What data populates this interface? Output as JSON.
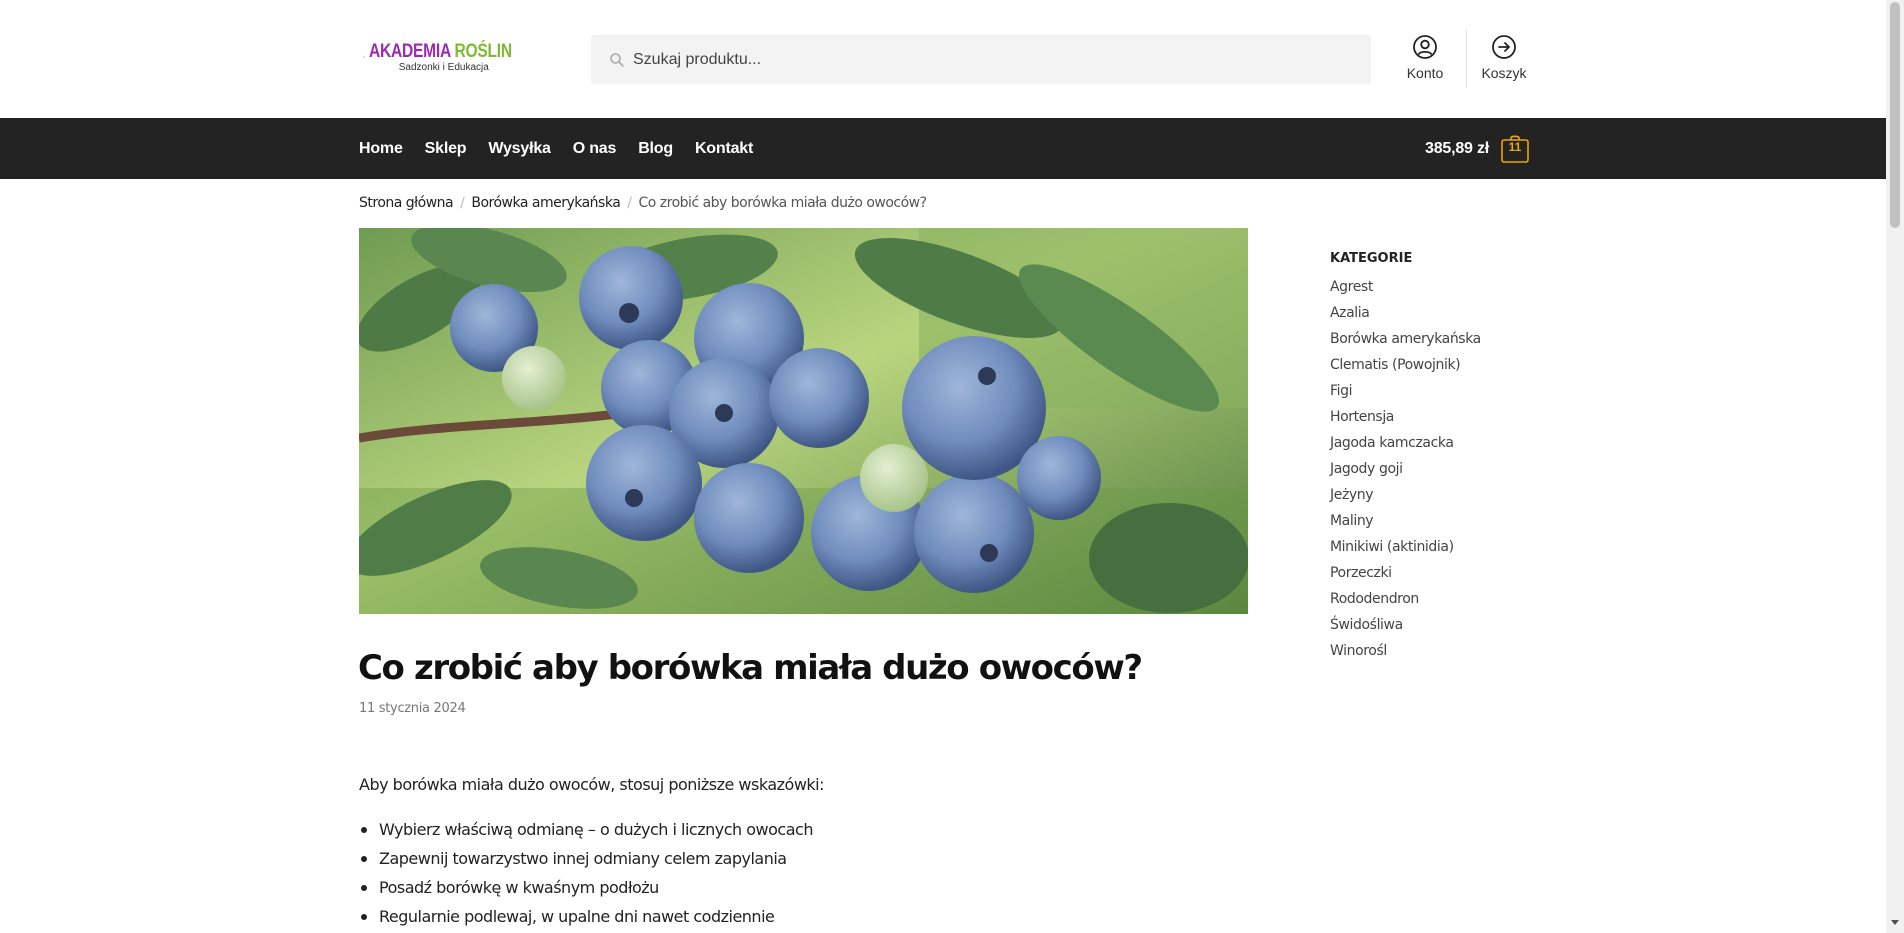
{
  "header": {
    "logo": {
      "title_part1": "AKADEMIA",
      "title_part2": "ROŚLIN",
      "subtitle": "Sadzonki i Edukacja"
    },
    "search": {
      "placeholder": "Szukaj produktu...",
      "value": ""
    },
    "account_label": "Konto",
    "cart_label": "Koszyk"
  },
  "nav": {
    "items": [
      "Home",
      "Sklep",
      "Wysyłka",
      "O nas",
      "Blog",
      "Kontakt"
    ],
    "cart_total": "385,89 zł",
    "cart_count": "11"
  },
  "breadcrumb": {
    "items": [
      "Strona główna",
      "Borówka amerykańska"
    ],
    "current": "Co zrobić aby borówka miała dużo owoców?",
    "separator": "/"
  },
  "article": {
    "title": "Co zrobić aby borówka miała dużo owoców?",
    "date": "11 stycznia 2024",
    "intro": "Aby borówka miała dużo owoców, stosuj poniższe wskazówki:",
    "tips": [
      "Wybierz właściwą odmianę – o dużych i licznych owocach",
      "Zapewnij towarzystwo innej odmiany celem zapylania",
      "Posadź borówkę w kwaśnym podłożu",
      "Regularnie podlewaj, w upalne dni nawet codziennie"
    ]
  },
  "sidebar": {
    "title": "KATEGORIE",
    "categories": [
      "Agrest",
      "Azalia",
      "Borówka amerykańska",
      "Clematis (Powojnik)",
      "Figi",
      "Hortensja",
      "Jagoda kamczacka",
      "Jagody goji",
      "Jeżyny",
      "Maliny",
      "Minikiwi (aktinidia)",
      "Porzeczki",
      "Rododendron",
      "Świdośliwa",
      "Winorośl"
    ]
  },
  "colors": {
    "nav_bg": "#232323",
    "logo_purple": "#9b2bb0",
    "logo_green": "#7cba2f",
    "cart_badge": "#f0a500"
  }
}
